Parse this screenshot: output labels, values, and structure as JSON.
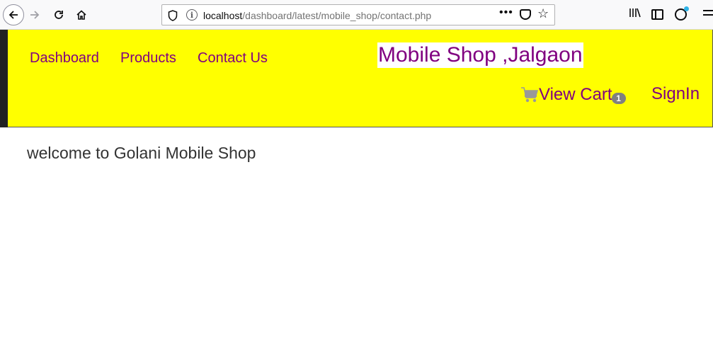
{
  "browser": {
    "url_host": "localhost",
    "url_path": "/dashboard/latest/mobile_shop/contact.php",
    "more_label": "•••"
  },
  "header": {
    "nav": [
      {
        "label": "Dashboard"
      },
      {
        "label": "Products"
      },
      {
        "label": "Contact Us"
      }
    ],
    "shop_title": "Mobile Shop ,Jalgaon",
    "cart_label": "View Cart",
    "cart_count": "1",
    "signin_label": "SignIn"
  },
  "main": {
    "welcome_text": "welcome to Golani Mobile Shop"
  },
  "colors": {
    "header_bg": "#ffff00",
    "link": "#800080",
    "badge": "#808080"
  }
}
